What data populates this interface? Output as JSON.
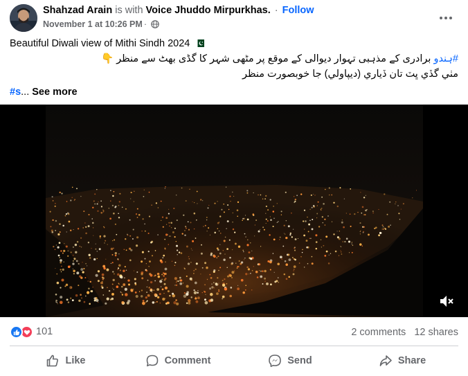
{
  "header": {
    "author": "Shahzad Arain",
    "with_text": "is with",
    "page": "Voice Jhuddo Mirpurkhas.",
    "dot": "·",
    "follow": "Follow",
    "timestamp": "November 1 at 10:26 PM",
    "separator": "·",
    "audience_icon": "globe-icon",
    "more_icon": "more-options-icon"
  },
  "caption": {
    "english": "Beautiful Diwali view of Mithi Sindh 2024",
    "flag_icon": "pakistan-flag-icon",
    "urdu_hashtag": "#ہندو",
    "urdu_text": "برادری کے مذہبی تہوار دیوالی کے موقع پر مٹھی شہر کا گڈی بھٹ سے منظر",
    "pointing_emoji": "👇",
    "sindhi_text": "مٺي گڏي ڀٽ تان ڏياري (ديپاولي) جا خوبصورت منظر",
    "hashtag_truncated": "#s",
    "ellipsis": "...",
    "see_more": "See more"
  },
  "video": {
    "mute_icon": "volume-muted-icon"
  },
  "stats": {
    "reaction_icons": [
      "like-reaction-icon",
      "love-reaction-icon"
    ],
    "reaction_count": "101",
    "comments": "2 comments",
    "shares": "12 shares"
  },
  "actions": {
    "like": "Like",
    "comment": "Comment",
    "send": "Send",
    "share": "Share"
  },
  "colors": {
    "accent": "#0866ff",
    "secondary_text": "#65676b",
    "like_blue": "#1877f2",
    "love_red": "#f33e58"
  }
}
